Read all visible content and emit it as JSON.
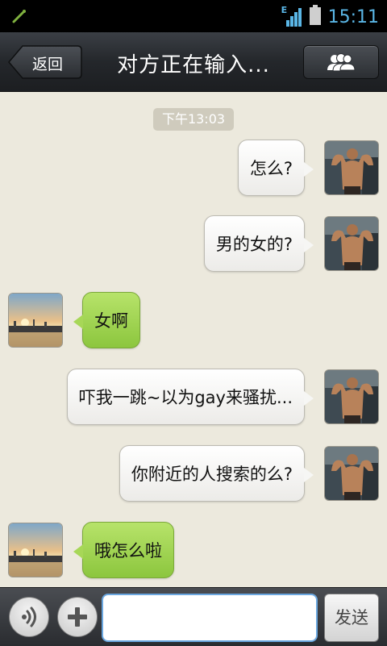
{
  "status_bar": {
    "time": "15:11",
    "network_label": "E"
  },
  "header": {
    "back_label": "返回",
    "title": "对方正在输入..."
  },
  "chat": {
    "timestamp": "下午13:03",
    "messages": [
      {
        "side": "out",
        "text": "怎么?"
      },
      {
        "side": "out",
        "text": "男的女的?"
      },
      {
        "side": "in",
        "text": "女啊"
      },
      {
        "side": "out",
        "text": "吓我一跳~以为gay来骚扰..."
      },
      {
        "side": "out",
        "text": "你附近的人搜索的么?"
      },
      {
        "side": "in",
        "text": "哦怎么啦"
      }
    ]
  },
  "input_bar": {
    "message_value": "",
    "send_label": "发送"
  },
  "colors": {
    "accent_clock": "#5ab6e6",
    "incoming_bubble": "#9ed14f",
    "chat_background": "#ece9dd"
  }
}
